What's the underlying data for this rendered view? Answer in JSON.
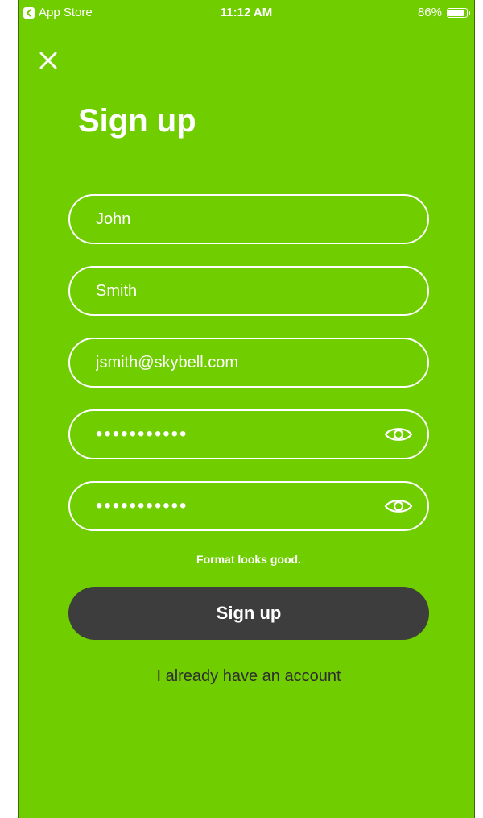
{
  "status_bar": {
    "back_app": "App Store",
    "time": "11:12 AM",
    "battery": "86%",
    "battery_level": 0.86
  },
  "header": {
    "close_icon": "close-icon",
    "title": "Sign up"
  },
  "form": {
    "first_name": "John",
    "last_name": "Smith",
    "email": "jsmith@skybell.com",
    "password": "•••••••••••",
    "confirm_password": "•••••••••••",
    "eye_icon": "eye-icon",
    "format_message": "Format looks good."
  },
  "actions": {
    "submit_label": "Sign up",
    "login_link": "I already have an account"
  },
  "colors": {
    "background": "#6fcd00",
    "button": "#3d3d3d",
    "text": "#ffffff"
  }
}
